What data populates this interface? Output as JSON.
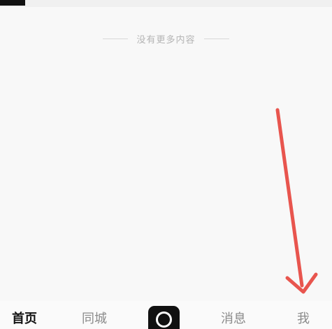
{
  "feed": {
    "end_text": "没有更多内容"
  },
  "bottom_nav": {
    "items": [
      {
        "label": "首页",
        "active": true
      },
      {
        "label": "同城",
        "active": false
      },
      {
        "label": "消息",
        "active": false
      },
      {
        "label": "我",
        "active": false
      }
    ],
    "create_icon": "camera-ring-icon"
  },
  "colors": {
    "annotation_arrow": "#e8554e",
    "active_text": "#111111",
    "inactive_text": "#8a8a8a"
  }
}
